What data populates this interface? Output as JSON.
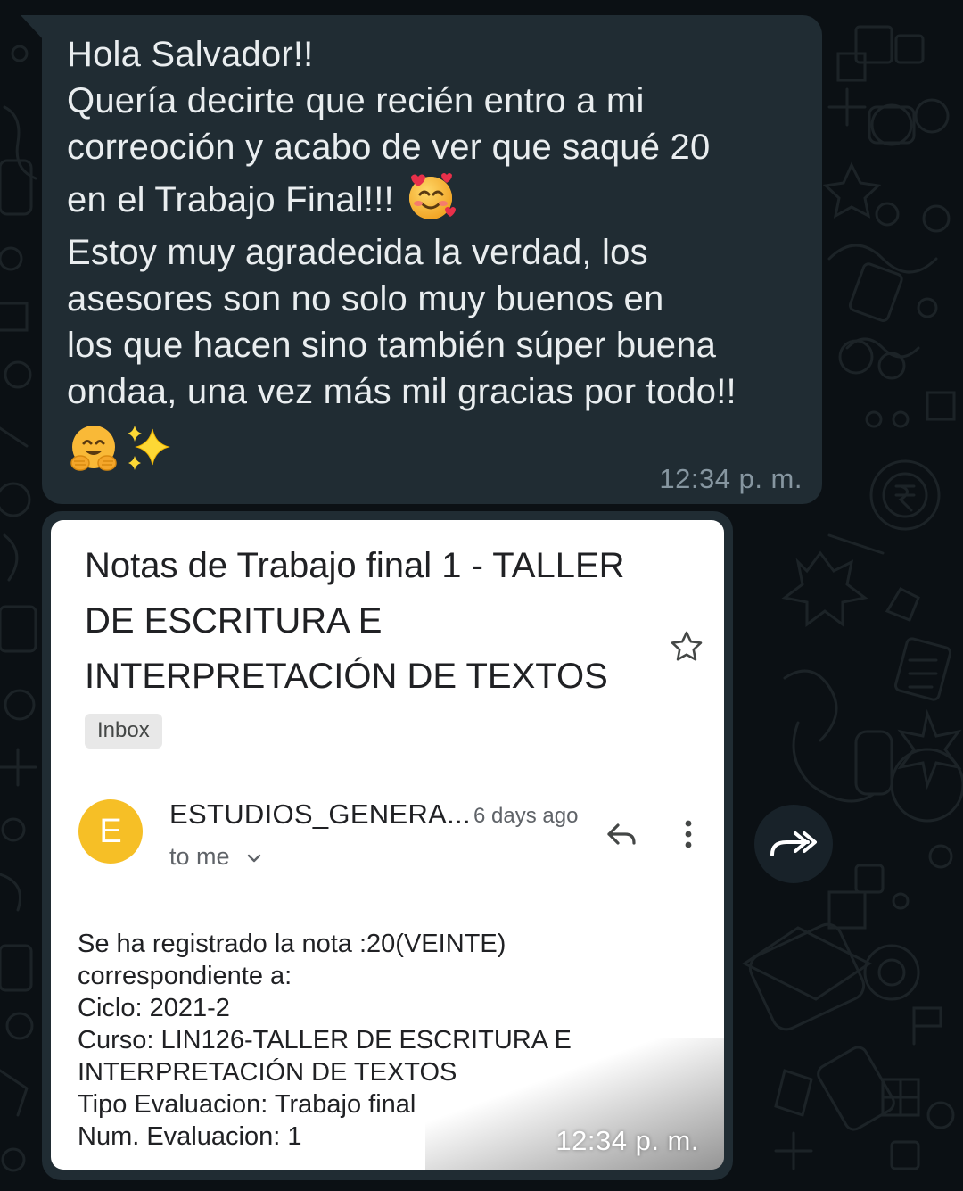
{
  "message": {
    "lines": [
      "Hola Salvador!!",
      "Quería decirte que recién entro a mi",
      "correoción y acabo de ver que saqué 20",
      "en el Trabajo Final!!!",
      "Estoy muy agradecida la verdad, los",
      "asesores son no solo muy buenos en",
      "los que hacen sino también súper buena",
      "ondaa, una vez más mil gracias por todo!!"
    ],
    "emojis": [
      "smiling-face-with-hearts",
      "hugging-face",
      "sparkles"
    ],
    "time": "12:34 p. m."
  },
  "email": {
    "subject": "Notas de Trabajo final 1 - TALLER DE ESCRITURA E INTERPRETACIÓN DE TEXTOS",
    "label": "Inbox",
    "avatar_letter": "E",
    "sender": "ESTUDIOS_GENERA...",
    "sent_ago": "6 days ago",
    "to": "to me",
    "body_lines": [
      "Se ha registrado la nota :20(VEINTE)",
      "correspondiente a:",
      "Ciclo: 2021-2",
      "Curso: LIN126-TALLER DE ESCRITURA E",
      "INTERPRETACIÓN DE TEXTOS",
      "Tipo Evaluacion: Trabajo final",
      "Num. Evaluacion: 1"
    ],
    "time": "12:34 p. m."
  },
  "colors": {
    "chat_background": "#0b1014",
    "bubble": "#202c33",
    "text": "#e9edef",
    "timestamp": "#8696a0",
    "avatar": "#f6bf26"
  },
  "icons": [
    "star-icon",
    "reply-icon",
    "more-vert-icon",
    "chevron-down-icon",
    "forward-icon"
  ]
}
